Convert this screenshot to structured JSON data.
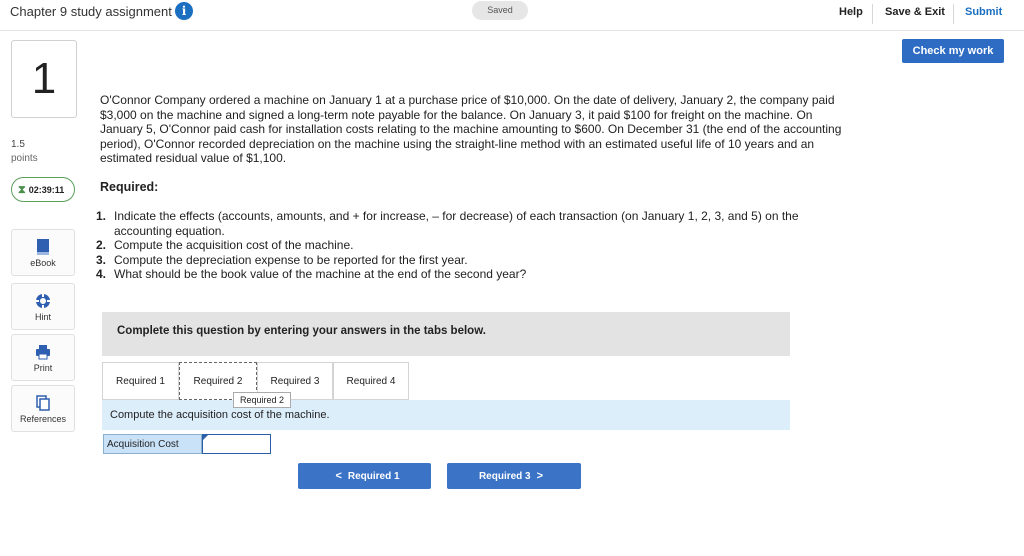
{
  "header": {
    "title": "Chapter 9 study assignment",
    "info_icon": "i",
    "saved_status": "Saved",
    "help": "Help",
    "save_exit": "Save & Exit",
    "submit": "Submit",
    "check_work": "Check my work"
  },
  "sidebar": {
    "question_number": "1",
    "points_value": "1.5",
    "points_label": "points",
    "timer": "02:39:11",
    "tools": [
      {
        "label": "eBook",
        "icon": "book-icon"
      },
      {
        "label": "Hint",
        "icon": "lifebuoy-icon"
      },
      {
        "label": "Print",
        "icon": "printer-icon"
      },
      {
        "label": "References",
        "icon": "documents-icon"
      }
    ]
  },
  "question": {
    "text": "O'Connor Company ordered a machine on January 1 at a purchase price of $10,000. On the date of delivery, January 2, the company paid $3,000 on the machine and signed a long-term note payable for the balance. On January 3, it paid $100 for freight on the machine. On January 5, O'Connor paid cash for installation costs relating to the machine amounting to $600. On December 31 (the end of the accounting period), O'Connor recorded depreciation on the machine using the straight-line method with an estimated useful life of 10 years and an estimated residual value of $1,100.",
    "required_heading": "Required:",
    "requirements": [
      {
        "num": "1.",
        "text": "Indicate the effects (accounts, amounts, and + for increase, – for decrease) of each transaction (on January 1, 2, 3, and 5) on the accounting equation."
      },
      {
        "num": "2.",
        "text": "Compute the acquisition cost of the machine."
      },
      {
        "num": "3.",
        "text": "Compute the depreciation expense to be reported for the first year."
      },
      {
        "num": "4.",
        "text": "What should be the book value of the machine at the end of the second year?"
      }
    ]
  },
  "answer_area": {
    "banner": "Complete this question by entering your answers in the tabs below.",
    "tabs": [
      "Required 1",
      "Required 2",
      "Required 3",
      "Required 4"
    ],
    "active_tab": "Required 2",
    "tooltip": "Required 2",
    "instruction": "Compute the acquisition cost of the machine.",
    "field_label": "Acquisition Cost",
    "field_value": "",
    "prev_button": "Required 1",
    "next_button": "Required 3"
  },
  "colors": {
    "accent": "#2e6cc4",
    "timer_border": "#5aa05a",
    "instruction_bg": "#ddeefb"
  }
}
